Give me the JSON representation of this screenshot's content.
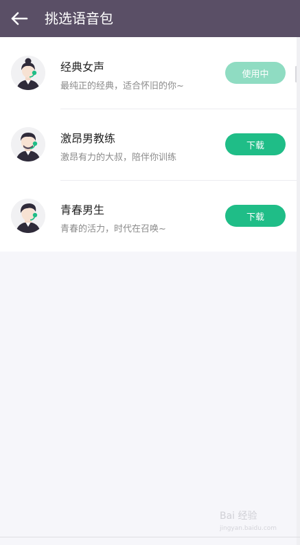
{
  "header": {
    "title": "挑选语音包",
    "back_icon": "arrow-left-icon"
  },
  "voices": [
    {
      "name": "经典女声",
      "description": "最纯正的经典，适合怀旧的你~",
      "action_label": "使用中",
      "action_state": "in-use",
      "avatar_icon": "female-avatar-icon"
    },
    {
      "name": "激昂男教练",
      "description": "激昂有力的大叔，陪伴你训练",
      "action_label": "下载",
      "action_state": "download",
      "avatar_icon": "male-coach-avatar-icon"
    },
    {
      "name": "青春男生",
      "description": "青春的活力，时代在召唤~",
      "action_label": "下载",
      "action_state": "download",
      "avatar_icon": "young-male-avatar-icon"
    }
  ],
  "watermark": {
    "text": "Bai 经验",
    "sub": "jingyan.baidu.com"
  },
  "colors": {
    "header_bg": "#5a4f66",
    "accent_green": "#1fbd87",
    "in_use_green": "#8fdcc2",
    "page_bg": "#f6f6fa"
  }
}
